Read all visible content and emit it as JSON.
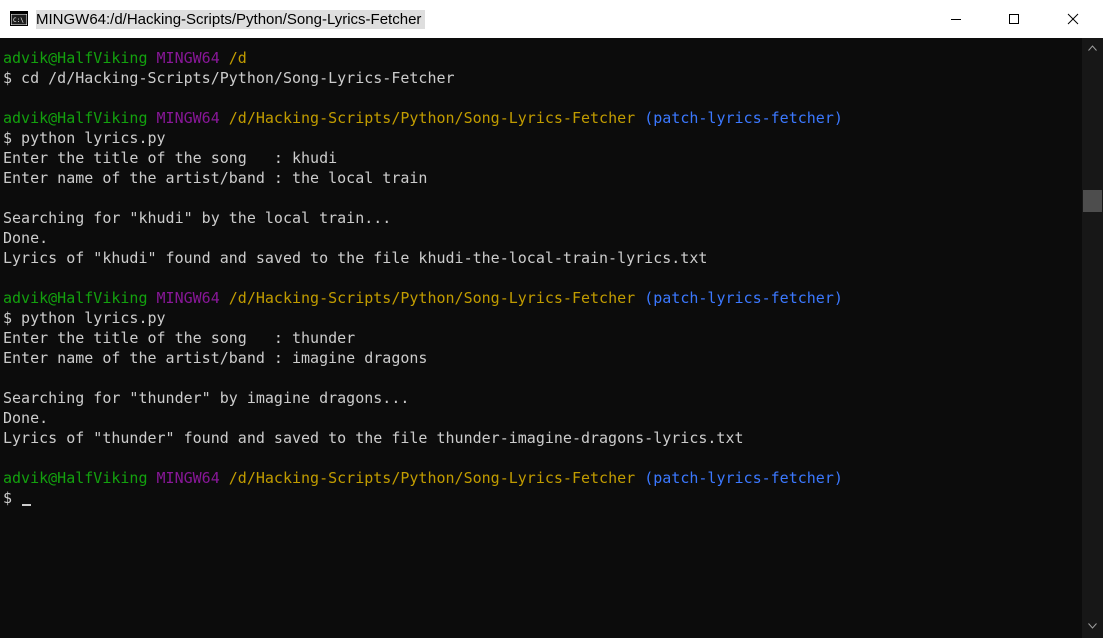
{
  "window": {
    "title": "MINGW64:/d/Hacking-Scripts/Python/Song-Lyrics-Fetcher",
    "icons": {
      "app": "console-app-icon",
      "minimize": "minimize-icon",
      "maximize": "maximize-icon",
      "close": "close-icon",
      "scroll_up": "scroll-up-arrow-icon",
      "scroll_down": "scroll-down-arrow-icon"
    }
  },
  "colors": {
    "background": "#0c0c0c",
    "text": "#cccccc",
    "user_host": "#13a10e",
    "system": "#881798",
    "path": "#c19c00",
    "branch": "#3b78ff"
  },
  "terminal": {
    "prompt1": {
      "user": "advik@HalfViking",
      "system": "MINGW64",
      "path": "/d",
      "branch": ""
    },
    "cmd1": "$ cd /d/Hacking-Scripts/Python/Song-Lyrics-Fetcher",
    "prompt2": {
      "user": "advik@HalfViking",
      "system": "MINGW64",
      "path": "/d/Hacking-Scripts/Python/Song-Lyrics-Fetcher",
      "branch": "(patch-lyrics-fetcher)"
    },
    "cmd2": "$ python lyrics.py",
    "out2": [
      "Enter the title of the song   : khudi",
      "Enter name of the artist/band : the local train",
      "Searching for \"khudi\" by the local train...",
      "Done.",
      "Lyrics of \"khudi\" found and saved to the file khudi-the-local-train-lyrics.txt"
    ],
    "prompt3": {
      "user": "advik@HalfViking",
      "system": "MINGW64",
      "path": "/d/Hacking-Scripts/Python/Song-Lyrics-Fetcher",
      "branch": "(patch-lyrics-fetcher)"
    },
    "cmd3": "$ python lyrics.py",
    "out3": [
      "Enter the title of the song   : thunder",
      "Enter name of the artist/band : imagine dragons",
      "Searching for \"thunder\" by imagine dragons...",
      "Done.",
      "Lyrics of \"thunder\" found and saved to the file thunder-imagine-dragons-lyrics.txt"
    ],
    "prompt4": {
      "user": "advik@HalfViking",
      "system": "MINGW64",
      "path": "/d/Hacking-Scripts/Python/Song-Lyrics-Fetcher",
      "branch": "(patch-lyrics-fetcher)"
    },
    "current_input": "$ "
  }
}
